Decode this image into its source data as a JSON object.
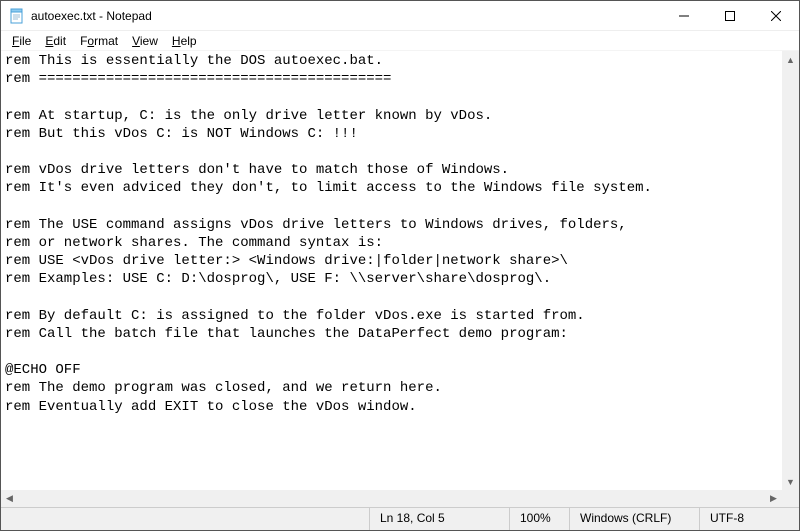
{
  "title": "autoexec.txt - Notepad",
  "menus": {
    "file": {
      "label": "File",
      "ul": "F",
      "rest": "ile"
    },
    "edit": {
      "label": "Edit",
      "ul": "E",
      "rest": "dit"
    },
    "format": {
      "label": "Format",
      "ul": "o",
      "pre": "F",
      "rest": "rmat"
    },
    "view": {
      "label": "View",
      "ul": "V",
      "rest": "iew"
    },
    "help": {
      "label": "Help",
      "ul": "H",
      "rest": "elp"
    }
  },
  "content": "rem This is essentially the DOS autoexec.bat.\nrem ==========================================\n\nrem At startup, C: is the only drive letter known by vDos.\nrem But this vDos C: is NOT Windows C: !!!\n\nrem vDos drive letters don't have to match those of Windows.\nrem It's even adviced they don't, to limit access to the Windows file system.\n\nrem The USE command assigns vDos drive letters to Windows drives, folders,\nrem or network shares. The command syntax is:\nrem USE <vDos drive letter:> <Windows drive:|folder|network share>\\\nrem Examples: USE C: D:\\dosprog\\, USE F: \\\\server\\share\\dosprog\\.\n\nrem By default C: is assigned to the folder vDos.exe is started from.\nrem Call the batch file that launches the DataPerfect demo program:\n\n@ECHO OFF\nrem The demo program was closed, and we return here.\nrem Eventually add EXIT to close the vDos window.",
  "status": {
    "position": "Ln 18, Col 5",
    "zoom": "100%",
    "eol": "Windows (CRLF)",
    "encoding": "UTF-8"
  },
  "scroll_arrows": {
    "up": "▲",
    "down": "▼",
    "left": "◀",
    "right": "▶"
  }
}
